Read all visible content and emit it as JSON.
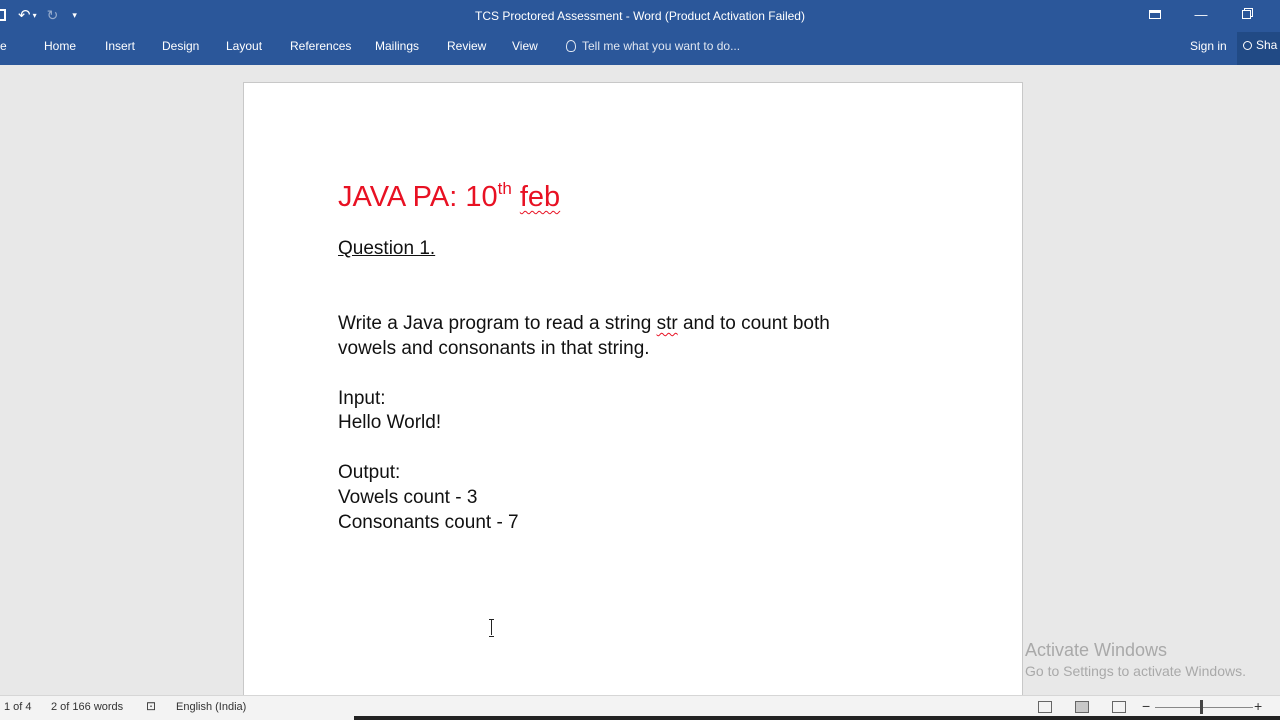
{
  "window": {
    "title": "TCS Proctored Assessment - Word (Product Activation Failed)"
  },
  "qat": {
    "save_icon": "save-icon",
    "undo_icon": "undo-icon",
    "redo_icon": "redo-icon",
    "customize_icon": "customize-icon"
  },
  "ribbon": {
    "file_label": "e",
    "tabs": [
      "Home",
      "Insert",
      "Design",
      "Layout",
      "References",
      "Mailings",
      "Review",
      "View"
    ],
    "tell_me": "Tell me what you want to do...",
    "sign_in": "Sign in",
    "share": "Sha"
  },
  "document": {
    "heading_main": "JAVA PA: 10",
    "heading_sup": "th",
    "heading_tail": "feb",
    "question": "Question 1.",
    "para_line1_a": "Write a Java program to read a string ",
    "para_line1_b": "str",
    "para_line1_c": " and to count both",
    "para_line2": "vowels and consonants in that string.",
    "input_label": "Input:",
    "input_value": "Hello World!",
    "output_label": "Output:",
    "output_line1": "Vowels count - 3",
    "output_line2": "Consonants count - 7"
  },
  "watermark": {
    "line1": "Activate Windows",
    "line2": "Go to Settings to activate Windows."
  },
  "status": {
    "page": "1 of 4",
    "words": "2 of 166 words",
    "language": "English (India)"
  },
  "colors": {
    "ribbon": "#2b579a",
    "heading": "#e81123"
  }
}
